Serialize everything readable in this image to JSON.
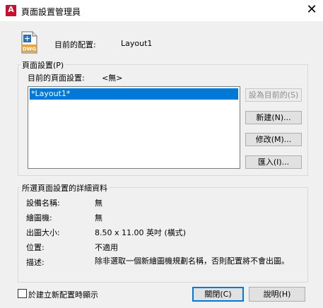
{
  "window": {
    "app_badge": "A",
    "title": "頁面設置管理員",
    "close_symbol": "✕"
  },
  "header": {
    "current_layout_label": "目前的配置:",
    "current_layout_value": "Layout1",
    "file_icon_text": "DWG"
  },
  "page_setups": {
    "legend": "頁面設置(P)",
    "current_label": "目前的頁面設置:",
    "current_value": "<無>",
    "items": [
      "*Layout1*"
    ],
    "buttons": {
      "set_current": "設為目前的(S)",
      "new": "新建(N)...",
      "modify": "修改(M)...",
      "import": "匯入(I)..."
    }
  },
  "details": {
    "legend": "所選頁面設置的詳細資料",
    "device_name_label": "設備名稱:",
    "device_name_value": "無",
    "plotter_label": "繪圖機:",
    "plotter_value": "無",
    "plot_size_label": "出圖大小:",
    "plot_size_value": "8.50 x 11.00 英吋 (橫式)",
    "location_label": "位置:",
    "location_value": "不適用",
    "description_label": "描述:",
    "description_value": "除非選取一個新繪圖機規劃名稱，否則配置將不會出圖。"
  },
  "footer": {
    "checkbox_label": "於建立新配置時顯示",
    "checkbox_checked": false,
    "close_button": "關閉(C)",
    "help_button": "說明(H)"
  },
  "colors": {
    "selection": "#0078d7",
    "app_badge": "#c8102e",
    "dialog_bg": "#f0f0f0"
  }
}
